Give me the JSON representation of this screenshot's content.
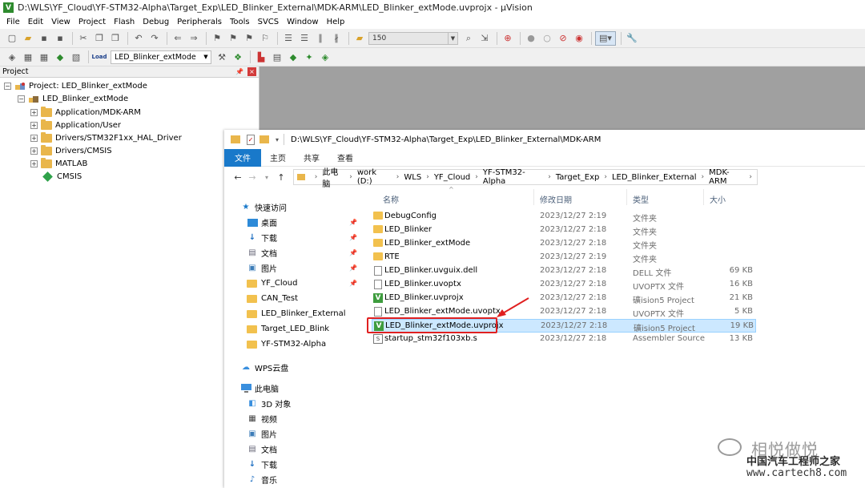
{
  "keil": {
    "title": "D:\\WLS\\YF_Cloud\\YF-STM32-Alpha\\Target_Exp\\LED_Blinker_External\\MDK-ARM\\LED_Blinker_extMode.uvprojx - µVision",
    "menu": [
      "File",
      "Edit",
      "View",
      "Project",
      "Flash",
      "Debug",
      "Peripherals",
      "Tools",
      "SVCS",
      "Window",
      "Help"
    ],
    "toolbar": {
      "combo_value": "150",
      "target_name": "LED_Blinker_extMode",
      "load_label": "Load"
    },
    "project_pane": {
      "header": "Project",
      "root": "Project: LED_Blinker_extMode",
      "target": "LED_Blinker_extMode",
      "groups": [
        "Application/MDK-ARM",
        "Application/User",
        "Drivers/STM32F1xx_HAL_Driver",
        "Drivers/CMSIS",
        "MATLAB"
      ],
      "cmsis": "CMSIS"
    }
  },
  "explorer": {
    "title_path": "D:\\WLS\\YF_Cloud\\YF-STM32-Alpha\\Target_Exp\\LED_Blinker_External\\MDK-ARM",
    "ribbon_tabs": [
      "文件",
      "主页",
      "共享",
      "查看"
    ],
    "breadcrumb": [
      "此电脑",
      "work (D:)",
      "WLS",
      "YF_Cloud",
      "YF-STM32-Alpha",
      "Target_Exp",
      "LED_Blinker_External",
      "MDK-ARM"
    ],
    "nav": {
      "quick_access": "快速访问",
      "pinned": [
        "桌面",
        "下载",
        "文档",
        "图片",
        "YF_Cloud"
      ],
      "recent": [
        "CAN_Test",
        "LED_Blinker_External",
        "Target_LED_Blink",
        "YF-STM32-Alpha"
      ],
      "wps": "WPS云盘",
      "this_pc": "此电脑",
      "pc_items": [
        "3D 对象",
        "视频",
        "图片",
        "文档",
        "下载",
        "音乐"
      ]
    },
    "columns": {
      "name": "名称",
      "date": "修改日期",
      "type": "类型",
      "size": "大小"
    },
    "files": [
      {
        "name": "DebugConfig",
        "date": "2023/12/27 2:19",
        "type": "文件夹",
        "size": "",
        "icon": "folder"
      },
      {
        "name": "LED_Blinker",
        "date": "2023/12/27 2:18",
        "type": "文件夹",
        "size": "",
        "icon": "folder"
      },
      {
        "name": "LED_Blinker_extMode",
        "date": "2023/12/27 2:18",
        "type": "文件夹",
        "size": "",
        "icon": "folder"
      },
      {
        "name": "RTE",
        "date": "2023/12/27 2:19",
        "type": "文件夹",
        "size": "",
        "icon": "folder"
      },
      {
        "name": "LED_Blinker.uvguix.dell",
        "date": "2023/12/27 2:18",
        "type": "DELL 文件",
        "size": "69 KB",
        "icon": "doc"
      },
      {
        "name": "LED_Blinker.uvoptx",
        "date": "2023/12/27 2:18",
        "type": "UVOPTX 文件",
        "size": "16 KB",
        "icon": "doc"
      },
      {
        "name": "LED_Blinker.uvprojx",
        "date": "2023/12/27 2:18",
        "type": "礦ision5 Project",
        "size": "21 KB",
        "icon": "uvision"
      },
      {
        "name": "LED_Blinker_extMode.uvoptx",
        "date": "2023/12/27 2:18",
        "type": "UVOPTX 文件",
        "size": "5 KB",
        "icon": "doc"
      },
      {
        "name": "LED_Blinker_extMode.uvprojx",
        "date": "2023/12/27 2:18",
        "type": "礦ision5 Project",
        "size": "19 KB",
        "icon": "uvision",
        "selected": true
      },
      {
        "name": "startup_stm32f103xb.s",
        "date": "2023/12/27 2:18",
        "type": "Assembler Source",
        "size": "13 KB",
        "icon": "asm"
      }
    ]
  },
  "watermark": {
    "main": "相悦做悦",
    "sub": "中国汽车工程师之家",
    "url": "www.cartech8.com"
  },
  "colors": {
    "accent": "#1979ca",
    "selection": "#cce8ff",
    "highlight": "#e02020",
    "folder": "#f2c14e"
  }
}
